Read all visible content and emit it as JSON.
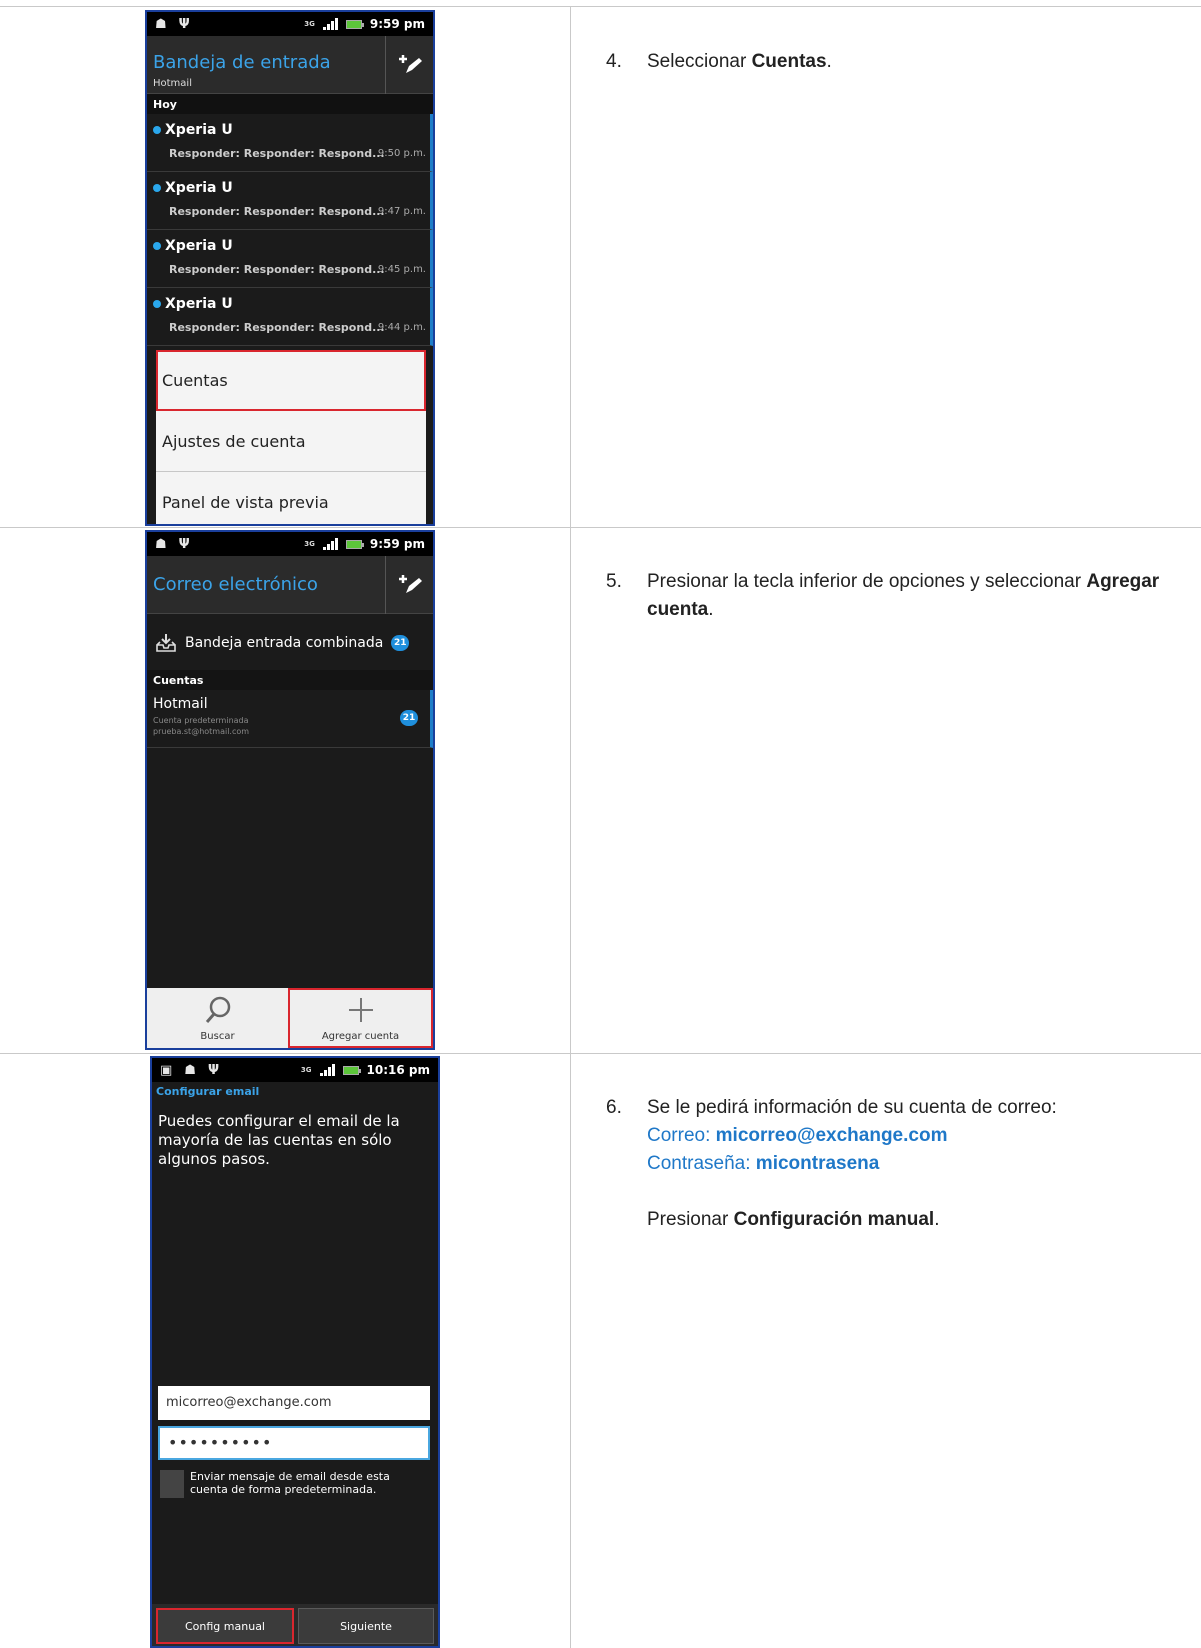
{
  "screen1": {
    "status_time": "9:59 pm",
    "network": "3G",
    "title": "Bandeja de entrada",
    "subtitle": "Hotmail",
    "section": "Hoy",
    "mails": [
      {
        "sender": "Xperia U",
        "subject": "Responder: Responder: Respond...",
        "time": "9:50 p.m."
      },
      {
        "sender": "Xperia U",
        "subject": "Responder: Responder: Respond...",
        "time": "9:47 p.m."
      },
      {
        "sender": "Xperia U",
        "subject": "Responder: Responder: Respond...",
        "time": "9:45 p.m."
      },
      {
        "sender": "Xperia U",
        "subject": "Responder: Responder: Respond...",
        "time": "9:44 p.m."
      }
    ],
    "menu": [
      "Cuentas",
      "Ajustes de cuenta",
      "Panel de vista previa"
    ]
  },
  "screen2": {
    "status_time": "9:59 pm",
    "network": "3G",
    "title": "Correo electrónico",
    "combined_label": "Bandeja entrada combinada",
    "combined_count": "21",
    "section": "Cuentas",
    "account": {
      "name": "Hotmail",
      "line1": "Cuenta predeterminada",
      "line2": "prueba.st@hotmail.com",
      "count": "21"
    },
    "buttons": {
      "search": "Buscar",
      "add": "Agregar cuenta"
    }
  },
  "screen3": {
    "status_time": "10:16 pm",
    "network": "3G",
    "title": "Configurar email",
    "description": "Puedes configurar el email de la mayoría de las cuentas en sólo algunos pasos.",
    "email_value": "micorreo@exchange.com",
    "password_mask": "••••••••••",
    "checkbox_label": "Enviar mensaje de email desde esta cuenta de forma predeterminada.",
    "buttons": {
      "manual": "Config manual",
      "next": "Siguiente"
    }
  },
  "steps": {
    "step4": {
      "num": "4.",
      "text": "Seleccionar ",
      "bold": "Cuentas",
      "end": "."
    },
    "step5": {
      "num": "5.",
      "text": "Presionar la tecla inferior de opciones y seleccionar ",
      "bold": "Agregar cuenta",
      "end": "."
    },
    "step6": {
      "num": "6.",
      "text": "Se le pedirá información de su cuenta de correo:",
      "email_label": "Correo: ",
      "email_value": "micorreo@exchange.com",
      "pass_label": "Contraseña: ",
      "pass_value": "micontrasena",
      "press": "Presionar ",
      "press_bold": "Configuración manual",
      "press_end": "."
    }
  },
  "colors": {
    "accent": "#3ba3e8",
    "highlight": "#d9262e",
    "frame": "#1a3f9c",
    "instruction_blue": "#1f78c8"
  }
}
